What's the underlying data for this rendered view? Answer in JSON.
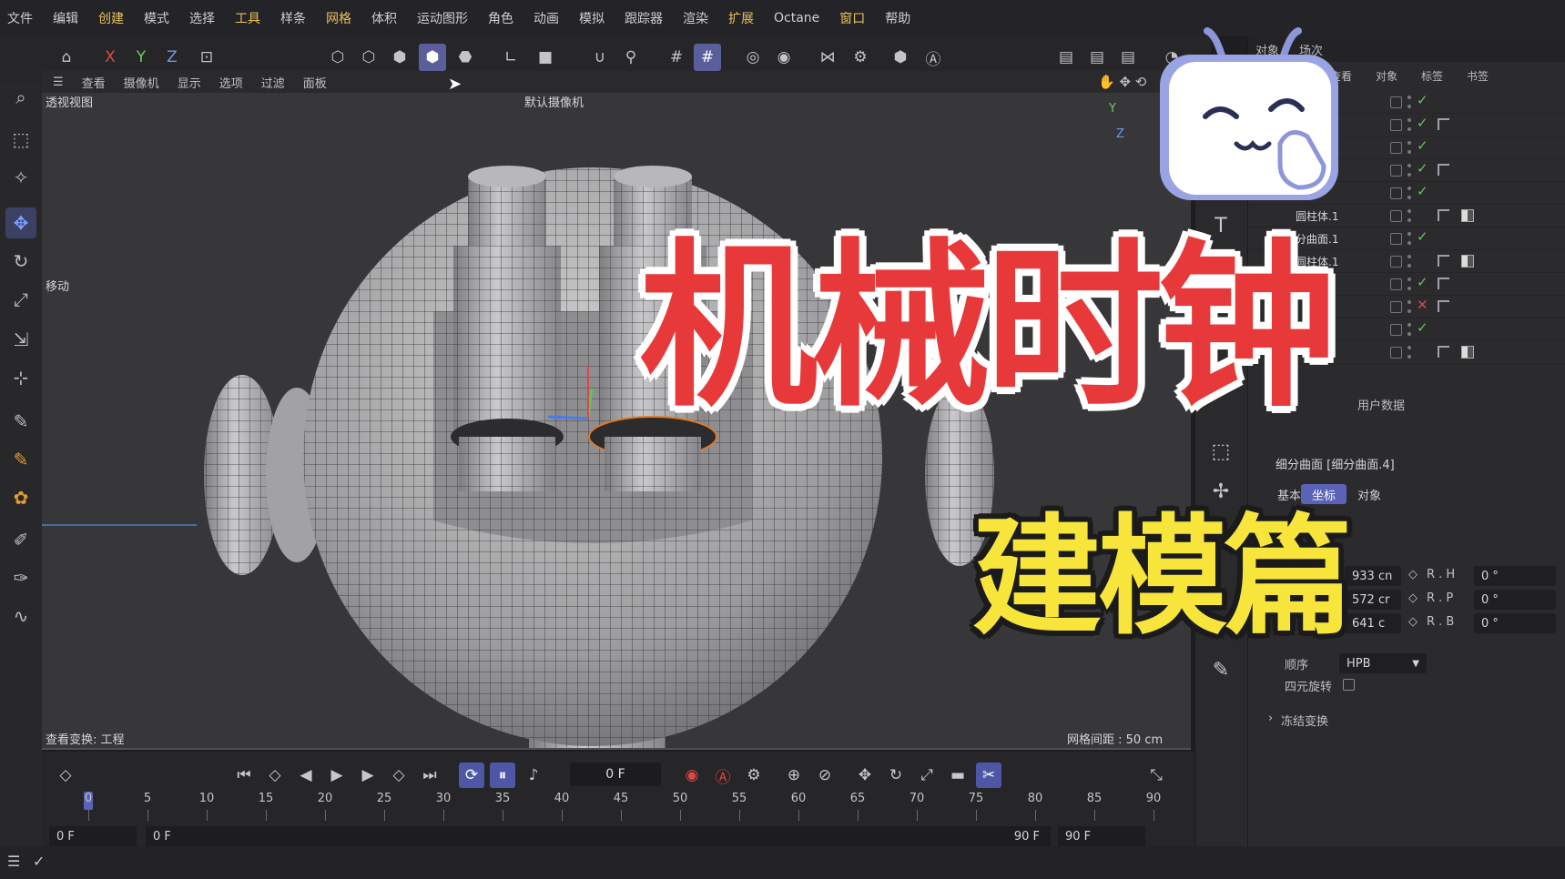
{
  "menu": [
    "文件",
    "编辑",
    "创建",
    "模式",
    "选择",
    "工具",
    "样条",
    "网格",
    "体积",
    "运动图形",
    "角色",
    "动画",
    "模拟",
    "跟踪器",
    "渲染",
    "扩展",
    "Octane",
    "窗口",
    "帮助"
  ],
  "toolbar": {
    "x": "X",
    "y": "Y",
    "z": "Z"
  },
  "viewport": {
    "menu": [
      "查看",
      "摄像机",
      "显示",
      "选项",
      "过滤",
      "面板"
    ],
    "name": "透视视图",
    "camera": "默认摄像机",
    "tool_label": "移动",
    "transform_info": "查看变换: 工程",
    "grid_spacing": "网格间距 : 50 cm"
  },
  "right_panel": {
    "tabs": [
      "对象",
      "场次"
    ],
    "sub_menu": [
      "查看",
      "对象",
      "标签",
      "书签"
    ],
    "objects": [
      {
        "name": "",
        "check": "✓"
      },
      {
        "name": "",
        "check": "✓"
      },
      {
        "name": "",
        "check": "✓"
      },
      {
        "name": "",
        "check": "✓"
      },
      {
        "name": "",
        "check": "✓"
      },
      {
        "name": "圆柱体.1",
        "check": ""
      },
      {
        "name": "细分曲面.1",
        "check": "✓"
      },
      {
        "name": "圆柱体.1",
        "check": ""
      },
      {
        "name": "",
        "check": "✓"
      },
      {
        "name": "",
        "check": "✕"
      },
      {
        "name": "",
        "check": "✓"
      },
      {
        "name": "",
        "check": ""
      }
    ],
    "attr_tab": "用户数据",
    "object_title": "细分曲面 [细分曲面.4]",
    "attr_buttons": [
      "基本",
      "坐标",
      "对象"
    ],
    "fields": [
      {
        "value": "933 cn",
        "label": "R . H",
        "angle": "0 °"
      },
      {
        "value": "572 cr",
        "label": "R . P",
        "angle": "0 °"
      },
      {
        "value": "641 c",
        "label": "R . B",
        "angle": "0 °"
      }
    ],
    "order_label": "顺序",
    "order_value": "HPB",
    "quat_label": "四元旋转",
    "freeze_label": "冻结变换"
  },
  "timeline": {
    "current_frame": "0 F",
    "ticks": [
      "0",
      "5",
      "10",
      "15",
      "20",
      "25",
      "30",
      "35",
      "40",
      "45",
      "50",
      "55",
      "60",
      "65",
      "70",
      "75",
      "80",
      "85",
      "90"
    ],
    "start": "0 F",
    "range_start": "0 F",
    "range_end": "90 F",
    "end": "90 F"
  },
  "overlay": {
    "title": "机械时钟",
    "subtitle": "建模篇"
  },
  "colors": {
    "accent": "#5a63b6",
    "title_red": "#e8393a",
    "subtitle_yellow": "#f7e53c",
    "check_green": "#62c655"
  }
}
